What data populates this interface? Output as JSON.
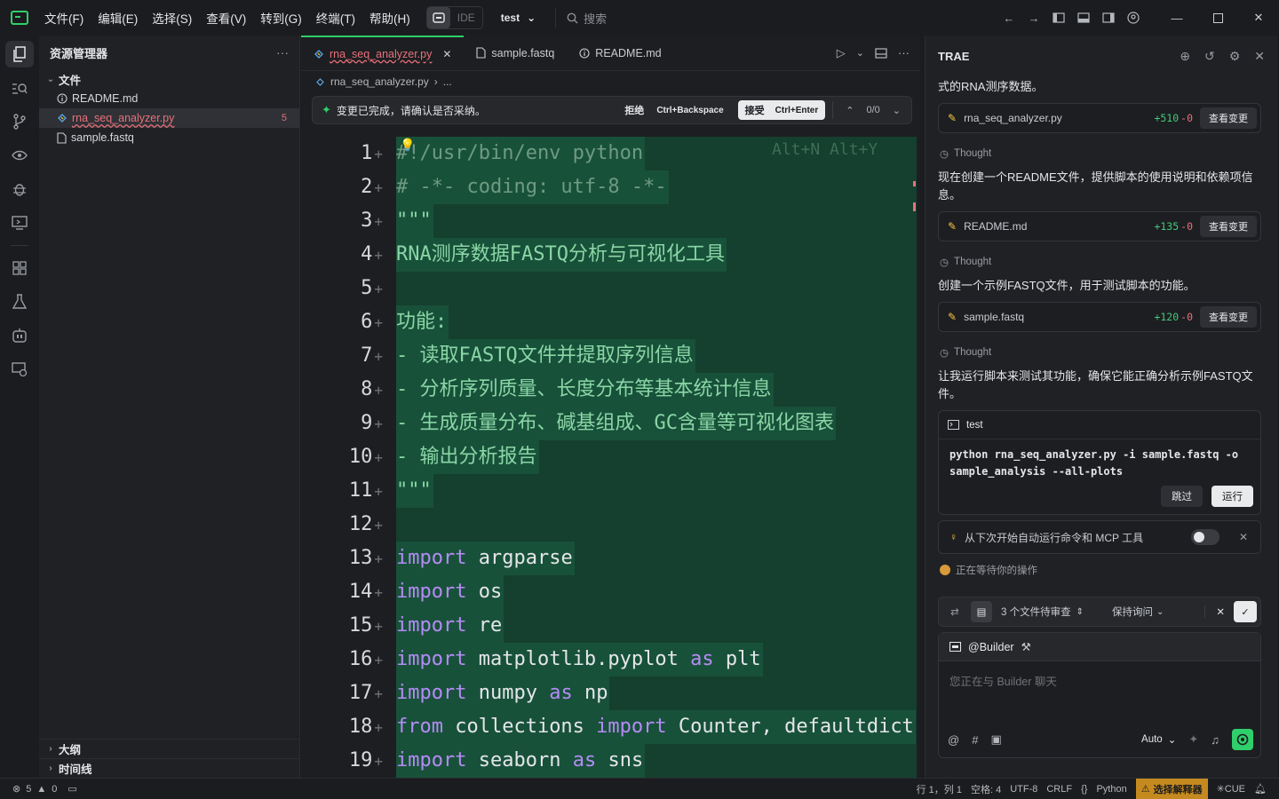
{
  "menu": [
    "文件(F)",
    "编辑(E)",
    "选择(S)",
    "查看(V)",
    "转到(G)",
    "终端(T)",
    "帮助(H)"
  ],
  "mode_toggle": {
    "ide_label": "IDE"
  },
  "project": {
    "name": "test"
  },
  "search": {
    "placeholder": "搜索"
  },
  "explorer": {
    "title": "资源管理器",
    "section": "文件",
    "files": [
      {
        "name": "README.md",
        "icon": "info-icon"
      },
      {
        "name": "rna_seq_analyzer.py",
        "icon": "python-icon",
        "errors": "5"
      },
      {
        "name": "sample.fastq",
        "icon": "file-icon"
      }
    ],
    "outline": "大纲",
    "timeline": "时间线"
  },
  "editor": {
    "tabs": [
      {
        "name": "rna_seq_analyzer.py",
        "active": true
      },
      {
        "name": "sample.fastq",
        "active": false
      },
      {
        "name": "README.md",
        "active": false
      }
    ],
    "breadcrumb": {
      "file": "rna_seq_analyzer.py",
      "rest": "..."
    },
    "review": {
      "message": "变更已完成，请确认是否采纳。",
      "reject_label": "拒绝",
      "reject_shortcut": "Ctrl+Backspace",
      "accept_label": "接受",
      "accept_shortcut": "Ctrl+Enter",
      "counter": "0/0"
    },
    "ghost_hint": "Alt+N Alt+Y",
    "lines": [
      {
        "n": "1",
        "text": "#!/usr/bin/env python"
      },
      {
        "n": "2",
        "text": "# -*- coding: utf-8 -*-"
      },
      {
        "n": "3",
        "text": "\"\"\""
      },
      {
        "n": "4",
        "text": "RNA测序数据FASTQ分析与可视化工具"
      },
      {
        "n": "5",
        "text": ""
      },
      {
        "n": "6",
        "text": "功能:"
      },
      {
        "n": "7",
        "text": "- 读取FASTQ文件并提取序列信息"
      },
      {
        "n": "8",
        "text": "- 分析序列质量、长度分布等基本统计信息"
      },
      {
        "n": "9",
        "text": "- 生成质量分布、碱基组成、GC含量等可视化图表"
      },
      {
        "n": "10",
        "text": "- 输出分析报告"
      },
      {
        "n": "11",
        "text": "\"\"\""
      },
      {
        "n": "12",
        "text": ""
      },
      {
        "n": "13",
        "kw": "import",
        "rest": " argparse"
      },
      {
        "n": "14",
        "kw": "import",
        "rest": " os"
      },
      {
        "n": "15",
        "kw": "import",
        "rest": " re"
      },
      {
        "n": "16",
        "kw": "import",
        "rest": " matplotlib.pyplot ",
        "kw2": "as",
        "rest2": " plt"
      },
      {
        "n": "17",
        "kw": "import",
        "rest": " numpy ",
        "kw2": "as",
        "rest2": " np"
      },
      {
        "n": "18",
        "kw": "from",
        "rest": " collections ",
        "kw2": "import",
        "rest2": " Counter, defaultdict"
      },
      {
        "n": "19",
        "kw": "import",
        "rest": " seaborn ",
        "kw2": "as",
        "rest2": " sns"
      }
    ]
  },
  "chat": {
    "title": "TRAE",
    "intro": "式的RNA测序数据。",
    "cards": [
      {
        "file": "rna_seq_analyzer.py",
        "adds": "+510",
        "dels": "-0",
        "button": "查看变更"
      },
      {
        "file": "README.md",
        "adds": "+135",
        "dels": "-0",
        "button": "查看变更"
      },
      {
        "file": "sample.fastq",
        "adds": "+120",
        "dels": "-0",
        "button": "查看变更"
      }
    ],
    "thought_label": "Thought",
    "msg1": "现在创建一个README文件，提供脚本的使用说明和依赖项信息。",
    "msg2": "创建一个示例FASTQ文件，用于测试脚本的功能。",
    "msg3": "让我运行脚本来测试其功能，确保它能正确分析示例FASTQ文件。",
    "terminal": {
      "title": "test",
      "command": "python rna_seq_analyzer.py -i sample.fastq -o sample_analysis --all-plots",
      "skip": "跳过",
      "run": "运行"
    },
    "auto_run": "从下次开始自动运行命令和 MCP 工具",
    "waiting": "正在等待你的操作",
    "pending": "3 个文件待审查",
    "keep_ask": "保持询问",
    "builder": "@Builder",
    "composer_placeholder": "您正在与 Builder 聊天",
    "model": "Auto"
  },
  "status": {
    "errors": "5",
    "warnings": "0",
    "position": "行 1，列 1",
    "spaces": "空格: 4",
    "encoding": "UTF-8",
    "eol": "CRLF",
    "braces": "{}",
    "language": "Python",
    "interpreter": "选择解释器",
    "cue": "CUE"
  },
  "colors": {
    "accent": "#2fcf6b",
    "added_bg": "#18513a",
    "error": "#e8707a",
    "warning": "#c58a1f"
  }
}
